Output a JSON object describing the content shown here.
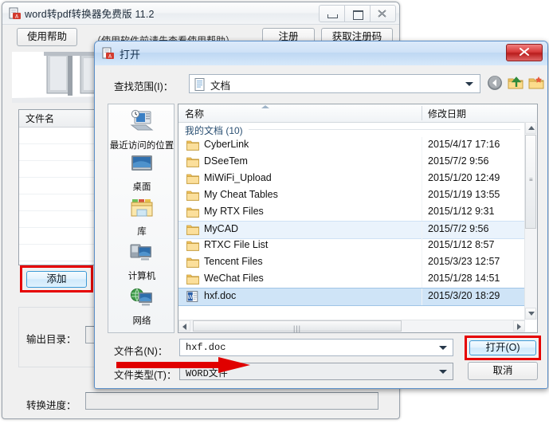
{
  "main_window": {
    "title": "word转pdf转换器免费版 11.2",
    "icon": "app-pdf-icon",
    "window_controls": {
      "minimize": "—",
      "maximize": "□",
      "close": "✕"
    },
    "toolbar": {
      "help_button": "使用帮助",
      "hint_text": "（使用软件前请先查看使用帮助）",
      "register_button": "注册",
      "get_code_button": "获取注册码"
    },
    "file_list": {
      "column_header": "文件名",
      "rows": []
    },
    "add_button": "添加",
    "output_label": "输出目录：",
    "progress_label": "转换进度："
  },
  "dialog": {
    "title": "打开",
    "icon": "app-pdf-icon",
    "close_button": "✕",
    "look_in": {
      "label": "查找范围(I)：",
      "value": "文档",
      "icon": "document-icon"
    },
    "toolbar_icons": [
      "back-icon",
      "up-folder-icon",
      "new-folder-icon",
      "view-mode-icon"
    ],
    "places": [
      {
        "label": "最近访问的位置",
        "icon": "recent-places-icon"
      },
      {
        "label": "桌面",
        "icon": "desktop-icon"
      },
      {
        "label": "库",
        "icon": "libraries-icon"
      },
      {
        "label": "计算机",
        "icon": "computer-icon"
      },
      {
        "label": "网络",
        "icon": "network-icon"
      }
    ],
    "columns": {
      "name": "名称",
      "date": "修改日期"
    },
    "group_header": "我的文档 (10)",
    "files": [
      {
        "name": "CyberLink",
        "date": "2015/4/17 17:16",
        "type": "folder",
        "selected": false
      },
      {
        "name": "DSeeTem",
        "date": "2015/7/2 9:56",
        "type": "folder",
        "selected": false
      },
      {
        "name": "MiWiFi_Upload",
        "date": "2015/1/20 12:49",
        "type": "folder",
        "selected": false
      },
      {
        "name": "My Cheat Tables",
        "date": "2015/1/19 13:55",
        "type": "folder",
        "selected": false
      },
      {
        "name": "My RTX Files",
        "date": "2015/1/12 9:31",
        "type": "folder",
        "selected": false
      },
      {
        "name": "MyCAD",
        "date": "2015/7/2 9:56",
        "type": "folder",
        "selected": "hover"
      },
      {
        "name": "RTXC File List",
        "date": "2015/1/12 8:57",
        "type": "folder",
        "selected": false
      },
      {
        "name": "Tencent Files",
        "date": "2015/3/23 12:57",
        "type": "folder",
        "selected": false
      },
      {
        "name": "WeChat Files",
        "date": "2015/1/28 14:51",
        "type": "folder",
        "selected": false
      },
      {
        "name": "hxf.doc",
        "date": "2015/3/20 18:29",
        "type": "doc",
        "selected": true
      }
    ],
    "file_name": {
      "label": "文件名(N)：",
      "value": "hxf.doc"
    },
    "file_type": {
      "label": "文件类型(T)：",
      "value": "WORD文件"
    },
    "open_button": "打开(O)",
    "cancel_button": "取消"
  },
  "annotations": {
    "highlight_color": "#e60000",
    "arrow_color": "#e00000",
    "highlights": [
      "add-button",
      "open-button"
    ],
    "arrow_target": "file-type-combo"
  }
}
